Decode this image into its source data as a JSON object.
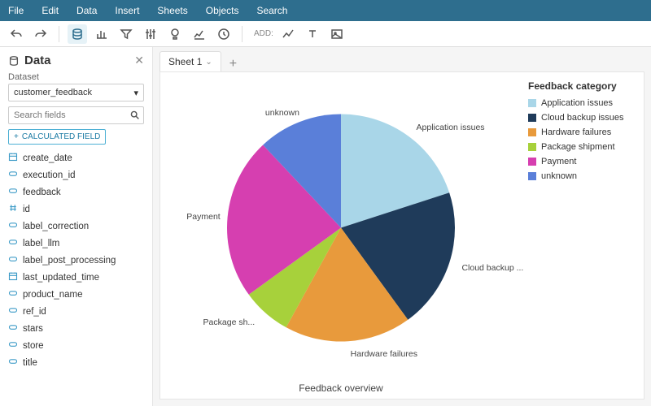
{
  "menu": {
    "items": [
      "File",
      "Edit",
      "Data",
      "Insert",
      "Sheets",
      "Objects",
      "Search"
    ]
  },
  "toolbar": {
    "add_label": "ADD:"
  },
  "sidebar": {
    "title": "Data",
    "dataset_label": "Dataset",
    "dataset_value": "customer_feedback",
    "search_placeholder": "Search fields",
    "calc_label": "CALCULATED FIELD",
    "fields": [
      {
        "name": "create_date",
        "type": "date"
      },
      {
        "name": "execution_id",
        "type": "string"
      },
      {
        "name": "feedback",
        "type": "string"
      },
      {
        "name": "id",
        "type": "number"
      },
      {
        "name": "label_correction",
        "type": "string"
      },
      {
        "name": "label_llm",
        "type": "string"
      },
      {
        "name": "label_post_processing",
        "type": "string"
      },
      {
        "name": "last_updated_time",
        "type": "date"
      },
      {
        "name": "product_name",
        "type": "string"
      },
      {
        "name": "ref_id",
        "type": "string"
      },
      {
        "name": "stars",
        "type": "string"
      },
      {
        "name": "store",
        "type": "string"
      },
      {
        "name": "title",
        "type": "string"
      }
    ]
  },
  "sheet": {
    "tab_label": "Sheet 1"
  },
  "chart_data": {
    "type": "pie",
    "title": "Feedback overview",
    "legend_title": "Feedback category",
    "categories": [
      "Application issues",
      "Cloud backup issues",
      "Hardware failures",
      "Package shipment",
      "Payment",
      "unknown"
    ],
    "values": [
      20,
      20,
      18,
      7,
      23,
      12
    ],
    "colors": [
      "#a9d6e8",
      "#1f3b5a",
      "#e89a3c",
      "#a7d13b",
      "#d63fb0",
      "#5a7fd9"
    ],
    "slice_labels": [
      "Application issues",
      "Cloud backup ...",
      "Hardware failures",
      "Package sh...",
      "Payment",
      "unknown"
    ]
  }
}
